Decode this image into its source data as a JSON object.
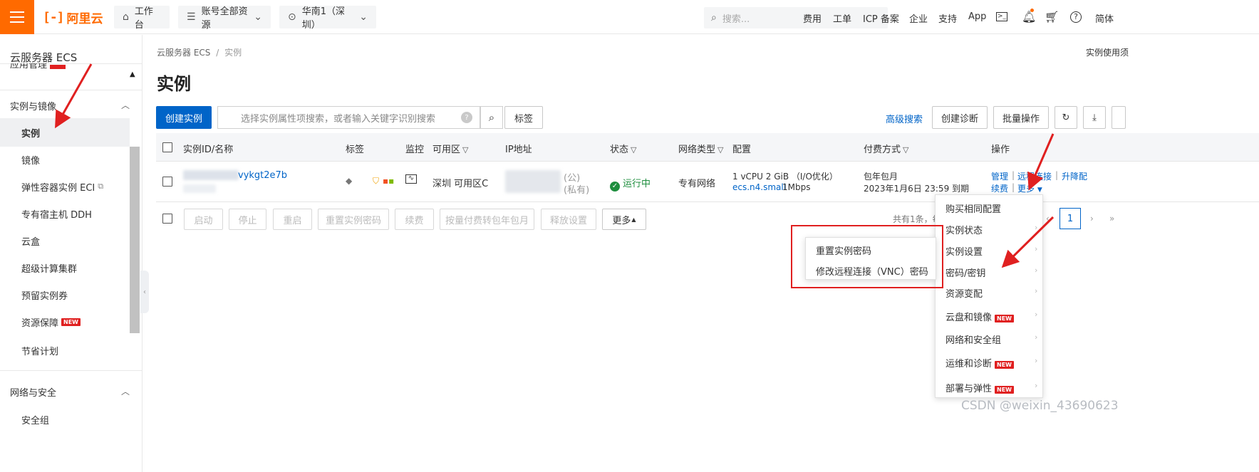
{
  "topbar": {
    "logo_text": "阿里云",
    "logo_mark": "[-]",
    "workbench": "工作台",
    "account_resources": "账号全部资源",
    "region": "华南1（深圳）",
    "search_placeholder": "搜索...",
    "nav": [
      "费用",
      "工单",
      "ICP 备案",
      "企业",
      "支持",
      "App"
    ],
    "lang": "简体",
    "accent_color": "#ff6a00"
  },
  "sidebar": {
    "title": "云服务器 ECS",
    "cut_item": "应用管理",
    "group_instances": "实例与镜像",
    "items": [
      {
        "label": "实例",
        "active": true
      },
      {
        "label": "镜像"
      },
      {
        "label": "弹性容器实例 ECI",
        "external": true
      },
      {
        "label": "专有宿主机 DDH"
      },
      {
        "label": "云盒"
      },
      {
        "label": "超级计算集群"
      },
      {
        "label": "预留实例券"
      },
      {
        "label": "资源保障",
        "badge": "NEW"
      },
      {
        "label": "节省计划"
      }
    ],
    "group_network": "网络与安全",
    "last_item": "安全组"
  },
  "breadcrumb": {
    "root": "云服务器 ECS",
    "sep": "/",
    "current": "实例"
  },
  "top_right_link": "实例使用须",
  "page_title": "实例",
  "toolbar": {
    "create": "创建实例",
    "filter_placeholder": "选择实例属性项搜索，或者输入关键字识别搜索",
    "help": "?",
    "tag": "标签",
    "advanced_search": "高级搜索",
    "create_diagnosis": "创建诊断",
    "batch_ops": "批量操作",
    "primary_color": "#0064c8"
  },
  "table": {
    "headers": [
      "实例ID/名称",
      "标签",
      "监控",
      "可用区",
      "IP地址",
      "状态",
      "网络类型",
      "配置",
      "付费方式",
      "操作"
    ],
    "row": {
      "instance_id_suffix": "vykgt2e7b",
      "zone": "深圳 可用区C",
      "ip_public_tag": "(公)",
      "ip_private_tag": "(私有)",
      "status": "运行中",
      "network": "专有网络",
      "config_line1": "1 vCPU 2 GiB （I/O优化）",
      "config_type": "ecs.n4.small",
      "bandwidth": "1Mbps",
      "pay_type": "包年包月",
      "expire": "2023年1月6日 23:59 到期",
      "ops": {
        "manage": "管理",
        "remote": "远程连接",
        "upgrade": "升降配",
        "renew": "续费",
        "more": "更多"
      }
    }
  },
  "footer": {
    "buttons": [
      "启动",
      "停止",
      "重启",
      "重置实例密码",
      "续费",
      "按量付费转包年包月",
      "释放设置",
      "更多"
    ],
    "total_text": "共有1条，每",
    "page": "1"
  },
  "more_menu": {
    "items": [
      "购买相同配置",
      "实例状态",
      "实例设置",
      "密码/密钥",
      "资源变配",
      "云盘和镜像",
      "网络和安全组",
      "运维和诊断",
      "部署与弹性"
    ],
    "new_badge": "NEW"
  },
  "password_submenu": {
    "items": [
      "重置实例密码",
      "修改远程连接（VNC）密码"
    ]
  },
  "watermark": "CSDN @weixin_43690623"
}
